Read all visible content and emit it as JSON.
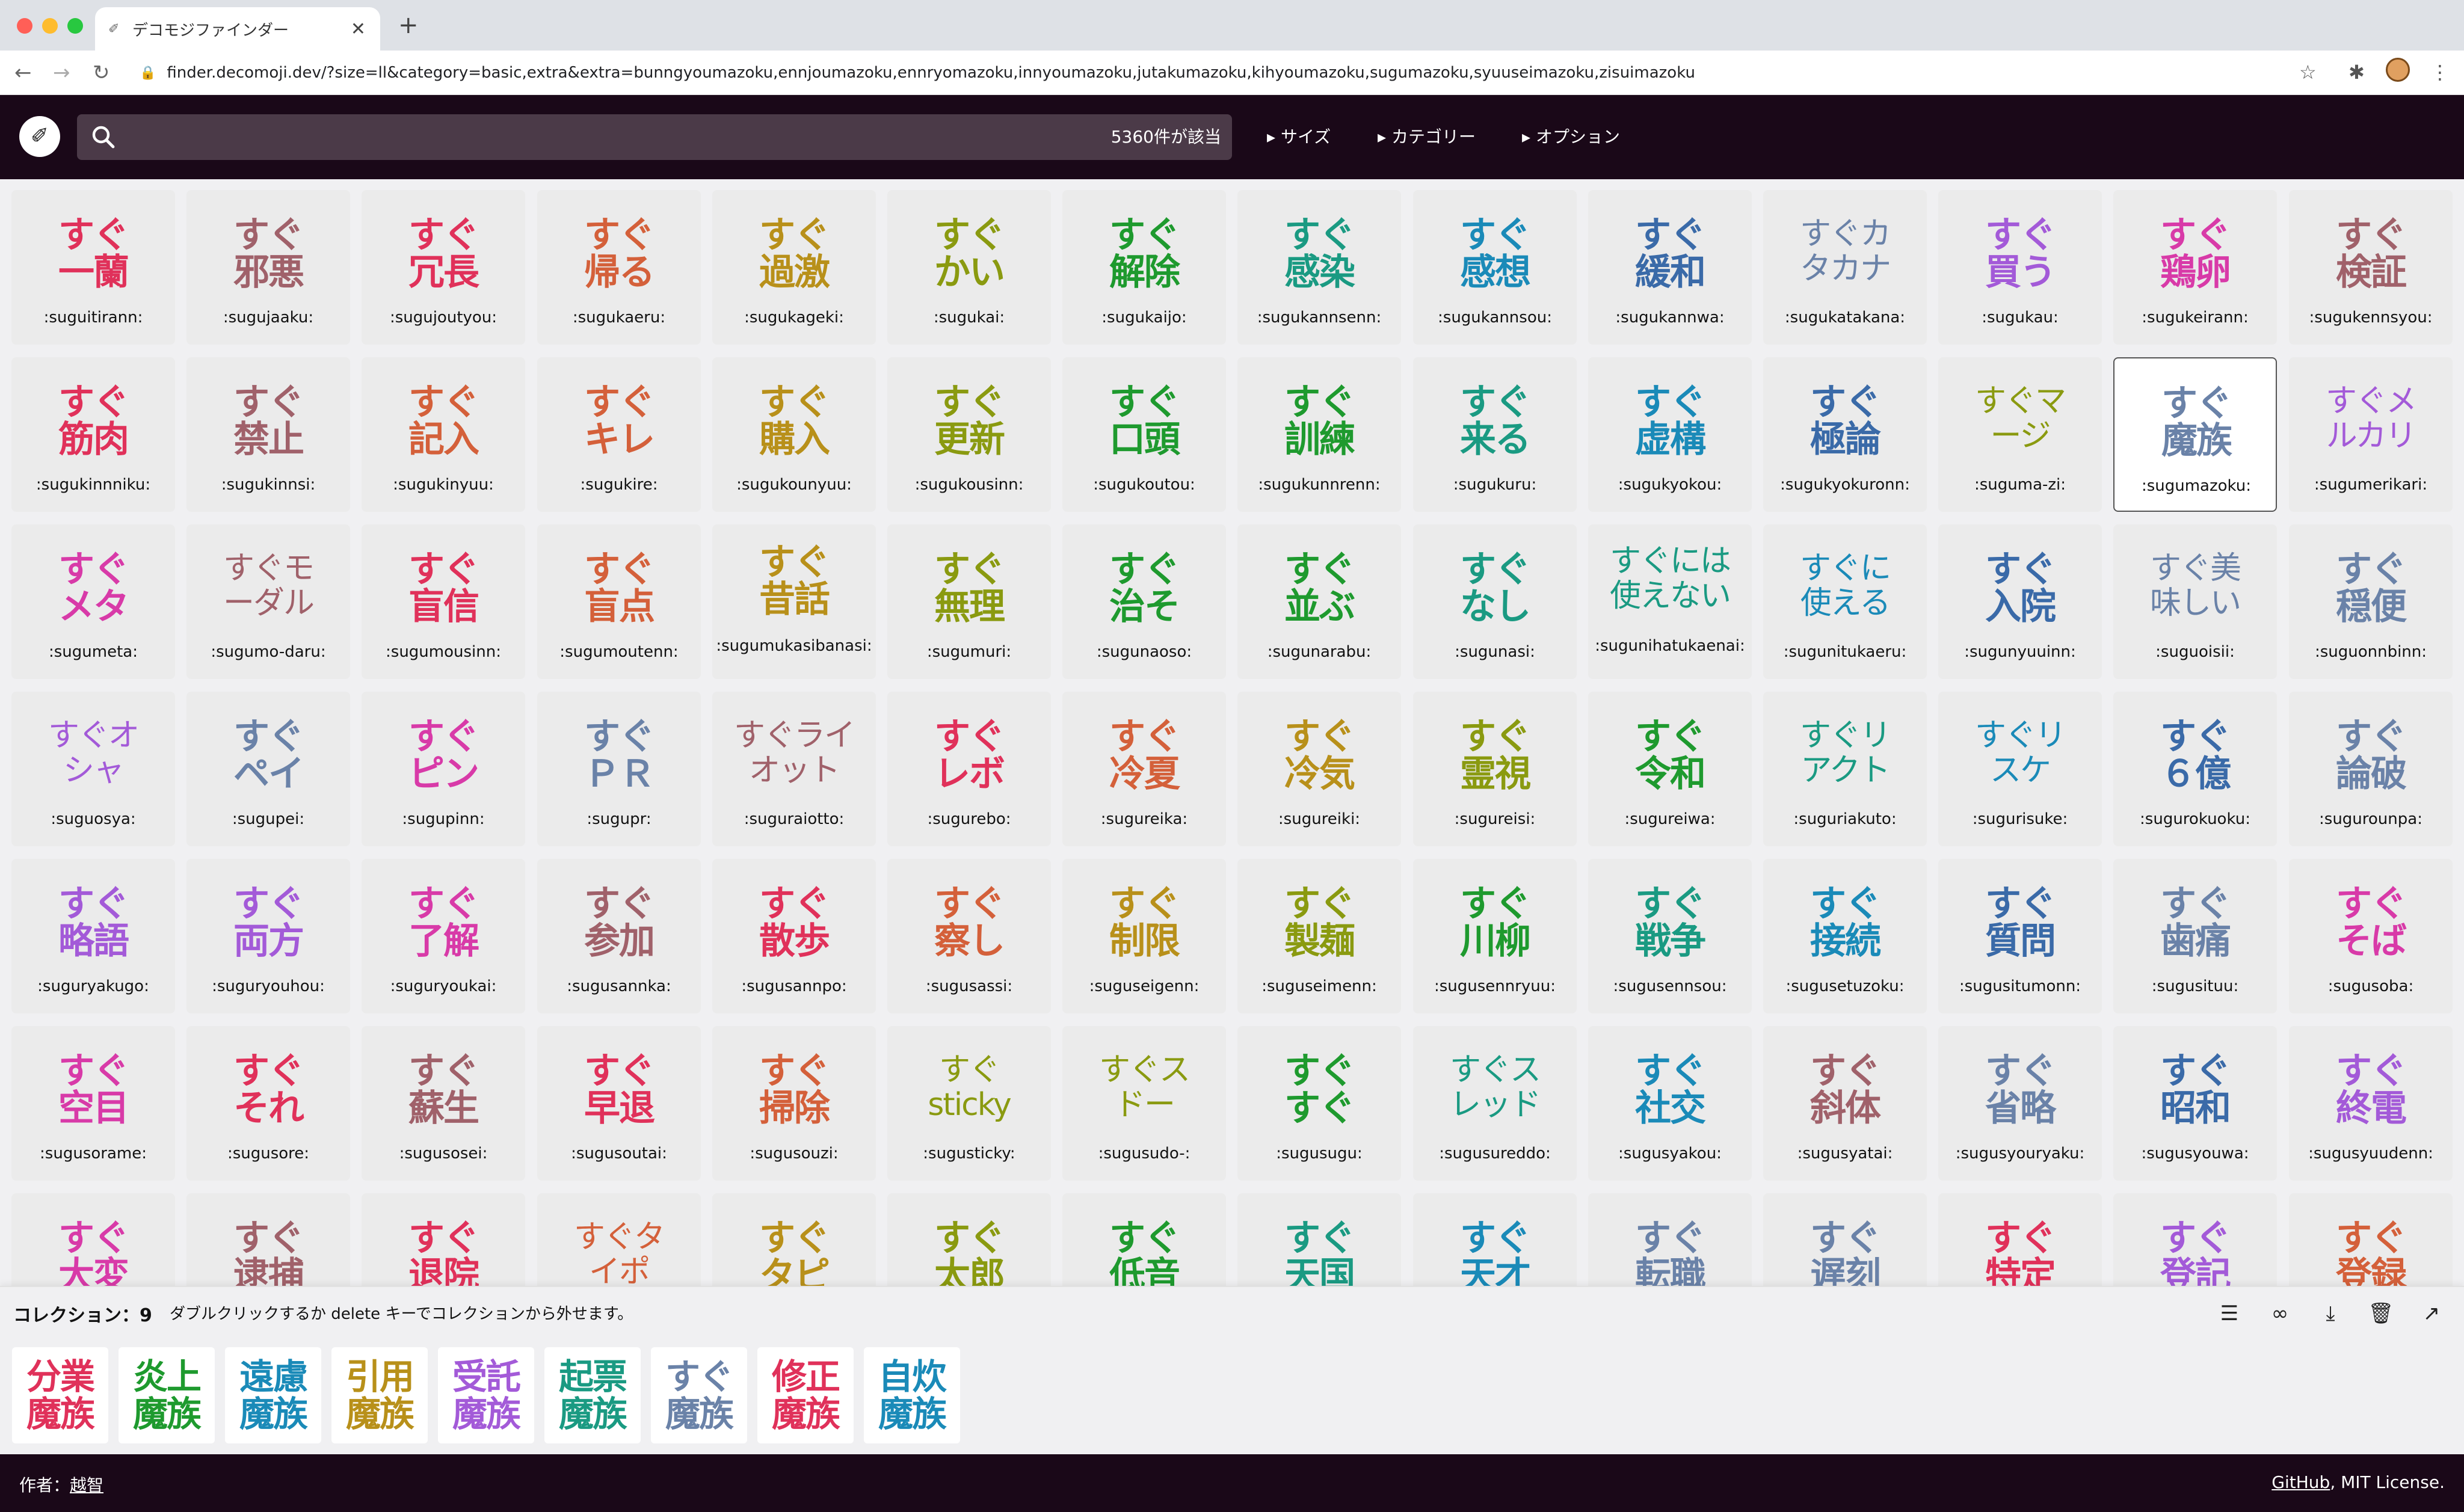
{
  "browser": {
    "tab_title": "デコモジファインダー",
    "url": "finder.decomoji.dev/?size=ll&category=basic,extra&extra=bunngyoumazoku,ennjoumazoku,ennryomazoku,innyoumazoku,jutakumazoku,kihyoumazoku,sugumazoku,syuuseimazoku,zisuimazoku"
  },
  "header": {
    "search_placeholder": "",
    "result_count": "5360件が該当",
    "menu": [
      "▸ サイズ",
      "▸ カテゴリー",
      "▸ オプション"
    ]
  },
  "emoji": [
    {
      "l1": "すぐ",
      "l2": "一蘭",
      "name": ":suguitirann:",
      "color": "#e0315a"
    },
    {
      "l1": "すぐ",
      "l2": "邪悪",
      "name": ":sugujaaku:",
      "color": "#a0616a"
    },
    {
      "l1": "すぐ",
      "l2": "冗長",
      "name": ":sugujoutyou:",
      "color": "#e0315a"
    },
    {
      "l1": "すぐ",
      "l2": "帰る",
      "name": ":sugukaeru:",
      "color": "#d4603a"
    },
    {
      "l1": "すぐ",
      "l2": "過激",
      "name": ":sugukageki:",
      "color": "#b8901a"
    },
    {
      "l1": "すぐ",
      "l2": "かい",
      "name": ":sugukai:",
      "color": "#8a9a10"
    },
    {
      "l1": "すぐ",
      "l2": "解除",
      "name": ":sugukaijo:",
      "color": "#1e9a2e"
    },
    {
      "l1": "すぐ",
      "l2": "感染",
      "name": ":sugukannsenn:",
      "color": "#1a9a82"
    },
    {
      "l1": "すぐ",
      "l2": "感想",
      "name": ":sugukannsou:",
      "color": "#1a8ab8"
    },
    {
      "l1": "すぐ",
      "l2": "緩和",
      "name": ":sugukannwa:",
      "color": "#3a6aa8"
    },
    {
      "l1": "すぐカ",
      "l2": "タカナ",
      "name": ":sugukatakana:",
      "color": "#6a82a8",
      "small": true
    },
    {
      "l1": "すぐ",
      "l2": "買う",
      "name": ":sugukau:",
      "color": "#a35ad8"
    },
    {
      "l1": "すぐ",
      "l2": "鶏卵",
      "name": ":sugukeirann:",
      "color": "#d83aa8"
    },
    {
      "l1": "すぐ",
      "l2": "検証",
      "name": ":sugukennsyou:",
      "color": "#a0616a"
    },
    {
      "l1": "すぐ",
      "l2": "筋肉",
      "name": ":sugukinnniku:",
      "color": "#e0315a"
    },
    {
      "l1": "すぐ",
      "l2": "禁止",
      "name": ":sugukinnsi:",
      "color": "#a0616a"
    },
    {
      "l1": "すぐ",
      "l2": "記入",
      "name": ":sugukinyuu:",
      "color": "#d4603a"
    },
    {
      "l1": "すぐ",
      "l2": "キレ",
      "name": ":sugukire:",
      "color": "#d4603a"
    },
    {
      "l1": "すぐ",
      "l2": "購入",
      "name": ":sugukounyuu:",
      "color": "#b8901a"
    },
    {
      "l1": "すぐ",
      "l2": "更新",
      "name": ":sugukousinn:",
      "color": "#8a9a10"
    },
    {
      "l1": "すぐ",
      "l2": "口頭",
      "name": ":sugukoutou:",
      "color": "#1e9a2e"
    },
    {
      "l1": "すぐ",
      "l2": "訓練",
      "name": ":sugukunnrenn:",
      "color": "#1e9a2e"
    },
    {
      "l1": "すぐ",
      "l2": "来る",
      "name": ":sugukuru:",
      "color": "#1a9a82"
    },
    {
      "l1": "すぐ",
      "l2": "虚構",
      "name": ":sugukyokou:",
      "color": "#1a8ab8"
    },
    {
      "l1": "すぐ",
      "l2": "極論",
      "name": ":sugukyokuronn:",
      "color": "#3a6aa8"
    },
    {
      "l1": "すぐマ",
      "l2": "ージ",
      "name": ":suguma-zi:",
      "color": "#8a9a10",
      "small": true
    },
    {
      "l1": "すぐ",
      "l2": "魔族",
      "name": ":sugumazoku:",
      "color": "#6a82a8",
      "selected": true
    },
    {
      "l1": "すぐメ",
      "l2": "ルカリ",
      "name": ":sugumerikari:",
      "color": "#a35ad8",
      "small": true
    },
    {
      "l1": "すぐ",
      "l2": "メタ",
      "name": ":sugumeta:",
      "color": "#d83aa8"
    },
    {
      "l1": "すぐモ",
      "l2": "ーダル",
      "name": ":sugumo-daru:",
      "color": "#a0616a",
      "small": true
    },
    {
      "l1": "すぐ",
      "l2": "盲信",
      "name": ":sugumousinn:",
      "color": "#e0315a"
    },
    {
      "l1": "すぐ",
      "l2": "盲点",
      "name": ":sugumoutenn:",
      "color": "#d4603a"
    },
    {
      "l1": "すぐ",
      "l2": "昔話",
      "name": ":sugumukasibanasi:",
      "color": "#b8901a",
      "raised": true
    },
    {
      "l1": "すぐ",
      "l2": "無理",
      "name": ":sugumuri:",
      "color": "#8a9a10"
    },
    {
      "l1": "すぐ",
      "l2": "治そ",
      "name": ":sugunaoso:",
      "color": "#1e9a2e"
    },
    {
      "l1": "すぐ",
      "l2": "並ぶ",
      "name": ":sugunarabu:",
      "color": "#1e9a2e"
    },
    {
      "l1": "すぐ",
      "l2": "なし",
      "name": ":sugunasi:",
      "color": "#1a9a82"
    },
    {
      "l1": "すぐには",
      "l2": "使えない",
      "name": ":sugunihatukaenai:",
      "color": "#1a9a82",
      "small": true,
      "raised": true
    },
    {
      "l1": "すぐに",
      "l2": "使える",
      "name": ":sugunitukaeru:",
      "color": "#1a8ab8",
      "small": true
    },
    {
      "l1": "すぐ",
      "l2": "入院",
      "name": ":sugunyuuinn:",
      "color": "#3a6aa8"
    },
    {
      "l1": "すぐ美",
      "l2": "味しい",
      "name": ":suguoisii:",
      "color": "#6a82a8",
      "small": true
    },
    {
      "l1": "すぐ",
      "l2": "穏便",
      "name": ":suguonnbinn:",
      "color": "#6a82a8"
    },
    {
      "l1": "すぐオ",
      "l2": "シャ",
      "name": ":suguosya:",
      "color": "#a35ad8",
      "small": true
    },
    {
      "l1": "すぐ",
      "l2": "ペイ",
      "name": ":sugupei:",
      "color": "#6a82a8"
    },
    {
      "l1": "すぐ",
      "l2": "ピン",
      "name": ":sugupinn:",
      "color": "#d83aa8"
    },
    {
      "l1": "すぐ",
      "l2": "ＰＲ",
      "name": ":sugupr:",
      "color": "#6a82a8"
    },
    {
      "l1": "すぐライ",
      "l2": "オット",
      "name": ":suguraiotto:",
      "color": "#a0616a",
      "small": true
    },
    {
      "l1": "すぐ",
      "l2": "レボ",
      "name": ":sugurebo:",
      "color": "#e0315a"
    },
    {
      "l1": "すぐ",
      "l2": "冷夏",
      "name": ":sugureika:",
      "color": "#d4603a"
    },
    {
      "l1": "すぐ",
      "l2": "冷気",
      "name": ":sugureiki:",
      "color": "#b8901a"
    },
    {
      "l1": "すぐ",
      "l2": "霊視",
      "name": ":sugureisi:",
      "color": "#8a9a10"
    },
    {
      "l1": "すぐ",
      "l2": "令和",
      "name": ":sugureiwa:",
      "color": "#1e9a2e"
    },
    {
      "l1": "すぐリ",
      "l2": "アクト",
      "name": ":suguriakuto:",
      "color": "#1a9a82",
      "small": true
    },
    {
      "l1": "すぐリ",
      "l2": "スケ",
      "name": ":sugurisuke:",
      "color": "#1a8ab8",
      "small": true
    },
    {
      "l1": "すぐ",
      "l2": "６億",
      "name": ":sugurokuoku:",
      "color": "#3a6aa8"
    },
    {
      "l1": "すぐ",
      "l2": "論破",
      "name": ":sugurounpa:",
      "color": "#6a82a8"
    },
    {
      "l1": "すぐ",
      "l2": "略語",
      "name": ":suguryakugo:",
      "color": "#a35ad8"
    },
    {
      "l1": "すぐ",
      "l2": "両方",
      "name": ":suguryouhou:",
      "color": "#a35ad8"
    },
    {
      "l1": "すぐ",
      "l2": "了解",
      "name": ":suguryoukai:",
      "color": "#d83aa8"
    },
    {
      "l1": "すぐ",
      "l2": "参加",
      "name": ":sugusannka:",
      "color": "#a0616a"
    },
    {
      "l1": "すぐ",
      "l2": "散歩",
      "name": ":sugusannpo:",
      "color": "#e0315a"
    },
    {
      "l1": "すぐ",
      "l2": "察し",
      "name": ":sugusassi:",
      "color": "#d4603a"
    },
    {
      "l1": "すぐ",
      "l2": "制限",
      "name": ":suguseigenn:",
      "color": "#b8901a"
    },
    {
      "l1": "すぐ",
      "l2": "製麺",
      "name": ":suguseimenn:",
      "color": "#8a9a10"
    },
    {
      "l1": "すぐ",
      "l2": "川柳",
      "name": ":sugusennryuu:",
      "color": "#1e9a2e"
    },
    {
      "l1": "すぐ",
      "l2": "戦争",
      "name": ":sugusennsou:",
      "color": "#1a9a82"
    },
    {
      "l1": "すぐ",
      "l2": "接続",
      "name": ":sugusetuzoku:",
      "color": "#1a8ab8"
    },
    {
      "l1": "すぐ",
      "l2": "質問",
      "name": ":sugusitumonn:",
      "color": "#3a6aa8"
    },
    {
      "l1": "すぐ",
      "l2": "歯痛",
      "name": ":sugusituu:",
      "color": "#6a82a8"
    },
    {
      "l1": "すぐ",
      "l2": "そば",
      "name": ":sugusoba:",
      "color": "#d83aa8"
    },
    {
      "l1": "すぐ",
      "l2": "空目",
      "name": ":sugusorame:",
      "color": "#d83aa8"
    },
    {
      "l1": "すぐ",
      "l2": "それ",
      "name": ":sugusore:",
      "color": "#e0315a"
    },
    {
      "l1": "すぐ",
      "l2": "蘇生",
      "name": ":sugusosei:",
      "color": "#a0616a"
    },
    {
      "l1": "すぐ",
      "l2": "早退",
      "name": ":sugusoutai:",
      "color": "#e0315a"
    },
    {
      "l1": "すぐ",
      "l2": "掃除",
      "name": ":sugusouzi:",
      "color": "#d4603a"
    },
    {
      "l1": "すぐ",
      "l2": "sticky",
      "name": ":sugusticky:",
      "color": "#8a9a10",
      "small": true
    },
    {
      "l1": "すぐス",
      "l2": "ドー",
      "name": ":sugusudo-:",
      "color": "#8a9a10",
      "small": true
    },
    {
      "l1": "すぐ",
      "l2": "すぐ",
      "name": ":sugusugu:",
      "color": "#1e9a2e"
    },
    {
      "l1": "すぐス",
      "l2": "レッド",
      "name": ":sugusureddo:",
      "color": "#1a9a82",
      "small": true
    },
    {
      "l1": "すぐ",
      "l2": "社交",
      "name": ":sugusyakou:",
      "color": "#1a8ab8"
    },
    {
      "l1": "すぐ",
      "l2": "斜体",
      "name": ":sugusyatai:",
      "color": "#a0616a"
    },
    {
      "l1": "すぐ",
      "l2": "省略",
      "name": ":sugusyouryaku:",
      "color": "#6a82a8"
    },
    {
      "l1": "すぐ",
      "l2": "昭和",
      "name": ":sugusyouwa:",
      "color": "#3a6aa8"
    },
    {
      "l1": "すぐ",
      "l2": "終電",
      "name": ":sugusyuudenn:",
      "color": "#a35ad8"
    },
    {
      "l1": "すぐ",
      "l2": "大変",
      "name": "",
      "color": "#d83aa8"
    },
    {
      "l1": "すぐ",
      "l2": "逮捕",
      "name": "",
      "color": "#a0616a"
    },
    {
      "l1": "すぐ",
      "l2": "退院",
      "name": "",
      "color": "#e0315a"
    },
    {
      "l1": "すぐタ",
      "l2": "イポ",
      "name": "",
      "color": "#d4603a",
      "small": true
    },
    {
      "l1": "すぐ",
      "l2": "タピ",
      "name": "",
      "color": "#b8901a"
    },
    {
      "l1": "すぐ",
      "l2": "太郎",
      "name": "",
      "color": "#8a9a10"
    },
    {
      "l1": "すぐ",
      "l2": "低音",
      "name": "",
      "color": "#1e9a2e"
    },
    {
      "l1": "すぐ",
      "l2": "天国",
      "name": "",
      "color": "#1a9a82"
    },
    {
      "l1": "すぐ",
      "l2": "天才",
      "name": "",
      "color": "#1a8ab8"
    },
    {
      "l1": "すぐ",
      "l2": "転職",
      "name": "",
      "color": "#6a82a8"
    },
    {
      "l1": "すぐ",
      "l2": "遅刻",
      "name": "",
      "color": "#6a82a8"
    },
    {
      "l1": "すぐ",
      "l2": "特定",
      "name": "",
      "color": "#e0315a"
    },
    {
      "l1": "すぐ",
      "l2": "登記",
      "name": "",
      "color": "#a35ad8"
    },
    {
      "l1": "すぐ",
      "l2": "登録",
      "name": "",
      "color": "#d4603a"
    }
  ],
  "collection": {
    "title": "コレクション：9",
    "hint": "ダブルクリックするか delete キーでコレクションから外せます。",
    "tools": [
      "sort-icon",
      "link-icon",
      "download-icon",
      "trash-icon",
      "external-icon"
    ],
    "items": [
      {
        "l1": "分業",
        "l2": "魔族",
        "color": "#e0315a"
      },
      {
        "l1": "炎上",
        "l2": "魔族",
        "color": "#1e9a2e"
      },
      {
        "l1": "遠慮",
        "l2": "魔族",
        "color": "#1a8ab8"
      },
      {
        "l1": "引用",
        "l2": "魔族",
        "color": "#b8901a"
      },
      {
        "l1": "受託",
        "l2": "魔族",
        "color": "#a35ad8"
      },
      {
        "l1": "起票",
        "l2": "魔族",
        "color": "#1a9a82"
      },
      {
        "l1": "すぐ",
        "l2": "魔族",
        "color": "#6a82a8"
      },
      {
        "l1": "修正",
        "l2": "魔族",
        "color": "#e0315a"
      },
      {
        "l1": "自炊",
        "l2": "魔族",
        "color": "#1a8ab8"
      }
    ]
  },
  "footer": {
    "author_label": "作者：",
    "author_name": "越智",
    "github": "GitHub",
    "license": ", MIT License."
  }
}
